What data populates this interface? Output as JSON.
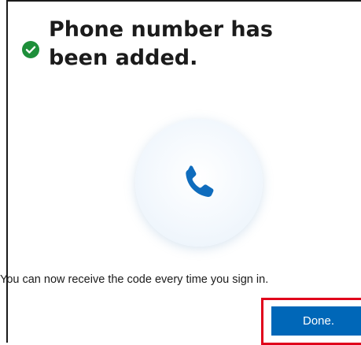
{
  "dialog": {
    "title": "Phone number has been added.",
    "message": "You can now receive the code every time you sign in.",
    "done_label": "Done."
  },
  "icons": {
    "status": "check-circle-icon",
    "illustration": "phone-icon"
  },
  "colors": {
    "success_green": "#1e8f3a",
    "phone_blue": "#0f6cbd",
    "button_blue": "#0067b8",
    "highlight_red": "#e0001b"
  }
}
